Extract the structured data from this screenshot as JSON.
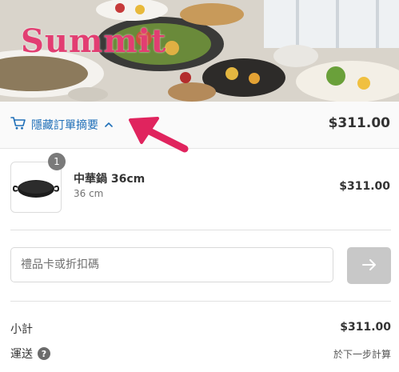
{
  "banner": {
    "brand": "Summit"
  },
  "order_summary": {
    "toggle_label": "隱藏訂單摘要",
    "total": "$311.00"
  },
  "line_item": {
    "quantity": "1",
    "name": "中華鍋 36cm",
    "variant": "36 cm",
    "price": "$311.00"
  },
  "discount": {
    "placeholder": "禮品卡或折扣碼",
    "apply_icon": "arrow-right-icon"
  },
  "totals": {
    "subtotal_label": "小計",
    "subtotal_value": "$311.00",
    "shipping_label": "運送",
    "shipping_value": "於下一步計算"
  },
  "colors": {
    "accent_link": "#1f6fb8",
    "brand_pink": "#e23e72",
    "arrow_pink": "#e0245e",
    "button_disabled": "#c8c8c8"
  }
}
